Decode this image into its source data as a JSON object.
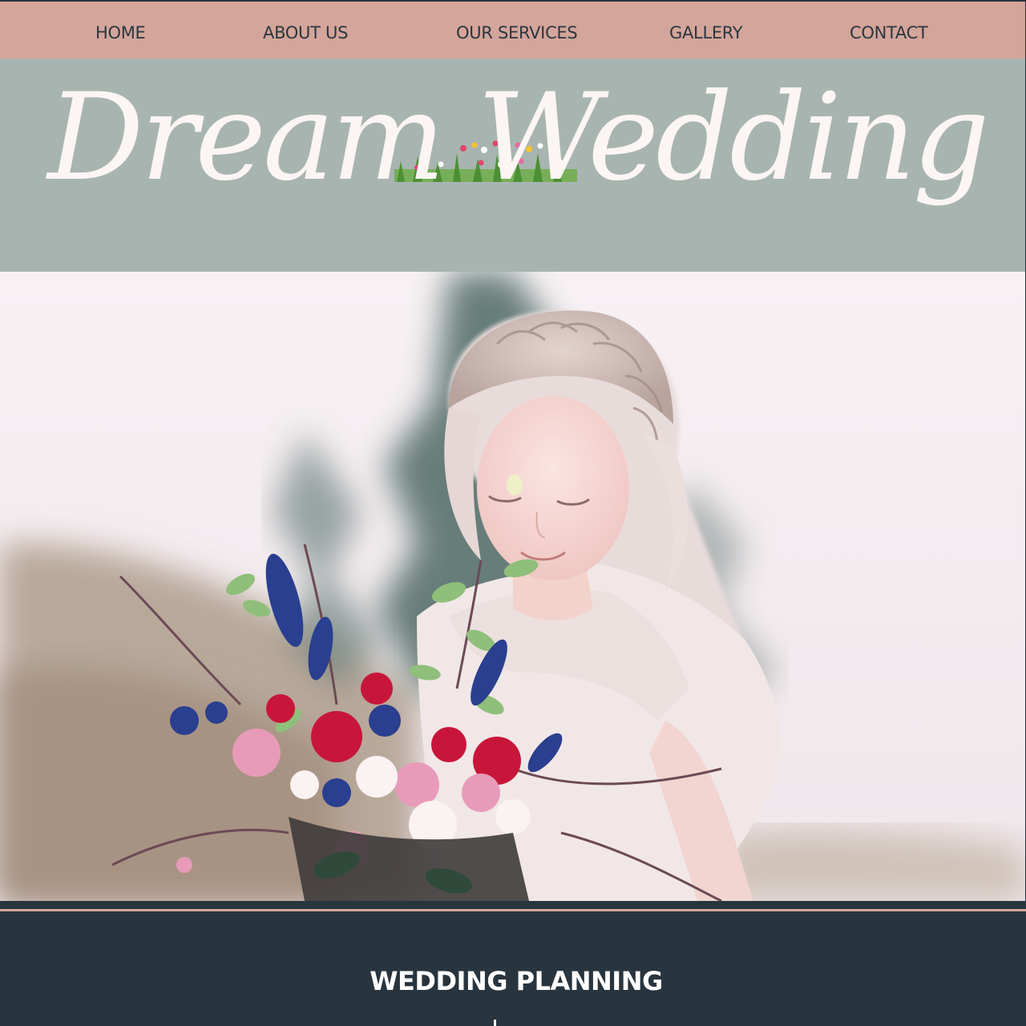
{
  "nav": {
    "items": [
      {
        "label": "HOME"
      },
      {
        "label": "ABOUT US"
      },
      {
        "label": "OUR SERVICES"
      },
      {
        "label": "GALLERY"
      },
      {
        "label": "CONTACT"
      }
    ]
  },
  "header": {
    "logo_text": "Dream Wedding"
  },
  "hero": {
    "image_alt": "bride-with-bouquet-photo"
  },
  "section": {
    "title": "WEDDING PLANNING"
  },
  "colors": {
    "nav_bg": "#d4a59a",
    "header_bg": "#a8b4b0",
    "section_bg": "#28343e",
    "accent": "#d4a59a"
  }
}
